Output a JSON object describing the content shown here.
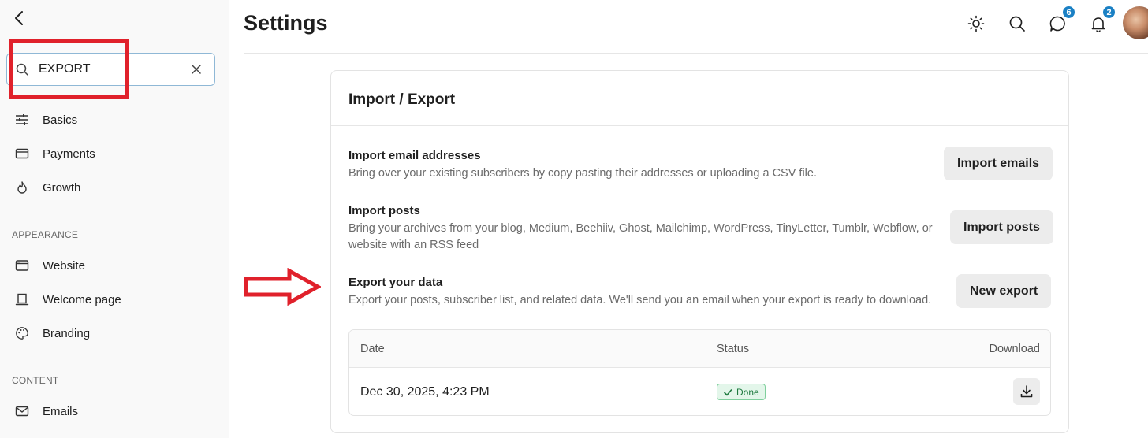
{
  "header": {
    "title": "Settings",
    "messages_badge": "6",
    "notifications_badge": "2"
  },
  "sidebar": {
    "search": {
      "value": "EXPORT",
      "placeholder": ""
    },
    "items_top": [
      {
        "label": "Basics",
        "icon": "sliders-icon"
      },
      {
        "label": "Payments",
        "icon": "credit-card-icon"
      },
      {
        "label": "Growth",
        "icon": "flame-icon"
      }
    ],
    "sections": {
      "appearance": "APPEARANCE",
      "content": "CONTENT"
    },
    "items_appearance": [
      {
        "label": "Website",
        "icon": "browser-window-icon"
      },
      {
        "label": "Welcome page",
        "icon": "kiosk-icon"
      },
      {
        "label": "Branding",
        "icon": "palette-icon"
      }
    ],
    "items_content": [
      {
        "label": "Emails",
        "icon": "mail-icon"
      }
    ]
  },
  "card": {
    "title": "Import / Export",
    "rows": [
      {
        "title": "Import email addresses",
        "description": "Bring over your existing subscribers by copy pasting their addresses or uploading a CSV file.",
        "button": "Import emails"
      },
      {
        "title": "Import posts",
        "description_line1": "Bring your archives from your blog, Medium, Beehiiv, Ghost, Mailchimp, WordPress, TinyLetter, Tumblr, Webflow, or",
        "description_line2": "website with an RSS feed",
        "button": "Import posts"
      },
      {
        "title": "Export your data",
        "description": "Export your posts, subscriber list, and related data. We'll send you an email when your export is ready to download.",
        "button": "New export"
      }
    ],
    "table": {
      "columns": [
        "Date",
        "Status",
        "Download"
      ],
      "rows": [
        {
          "date": "Dec 30, 2025, 4:23 PM",
          "status": "Done"
        }
      ]
    }
  },
  "colors": {
    "accent": "#1a80c4",
    "annotation": "#e0212b",
    "success": "#1e7a3f"
  }
}
